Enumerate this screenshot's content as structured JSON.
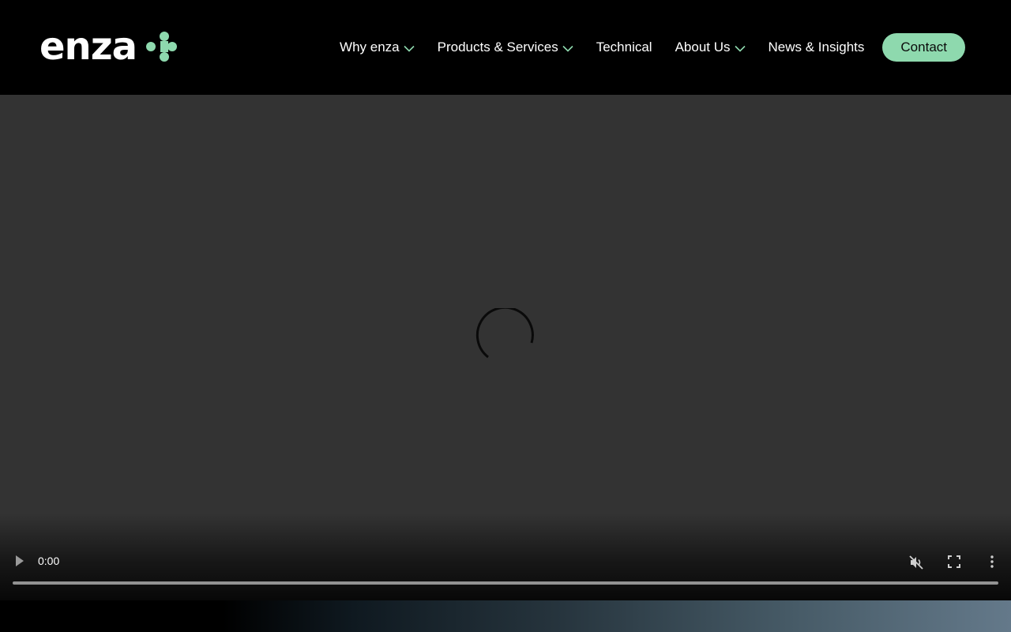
{
  "brand": {
    "name": "enza",
    "accent_color": "#8ed9ae",
    "logo_icon": "green-dots-arrow-icon"
  },
  "nav": {
    "items": [
      {
        "label": "Why enza",
        "has_dropdown": true
      },
      {
        "label": "Products & Services",
        "has_dropdown": true
      },
      {
        "label": "Technical",
        "has_dropdown": false
      },
      {
        "label": "About Us",
        "has_dropdown": true
      },
      {
        "label": "News & Insights",
        "has_dropdown": false
      }
    ],
    "contact_label": "Contact"
  },
  "video": {
    "state": "loading",
    "current_time": "0:00",
    "muted": true,
    "icons": [
      "play-icon",
      "mute-icon",
      "fullscreen-icon",
      "more-options-icon",
      "loading-spinner-icon"
    ]
  }
}
